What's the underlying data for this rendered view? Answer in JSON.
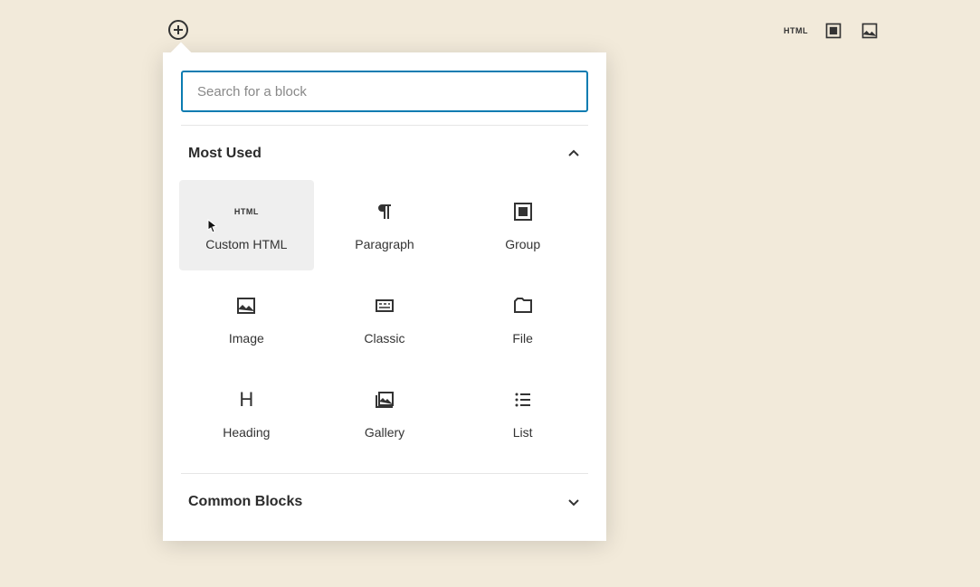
{
  "search": {
    "placeholder": "Search for a block"
  },
  "toolbar": {
    "html_label": "HTML"
  },
  "categories": [
    {
      "title": "Most Used",
      "expanded": true,
      "blocks": [
        {
          "label": "Custom HTML",
          "icon": "html"
        },
        {
          "label": "Paragraph",
          "icon": "paragraph"
        },
        {
          "label": "Group",
          "icon": "group"
        },
        {
          "label": "Image",
          "icon": "image"
        },
        {
          "label": "Classic",
          "icon": "classic"
        },
        {
          "label": "File",
          "icon": "file"
        },
        {
          "label": "Heading",
          "icon": "heading"
        },
        {
          "label": "Gallery",
          "icon": "gallery"
        },
        {
          "label": "List",
          "icon": "list"
        }
      ]
    },
    {
      "title": "Common Blocks",
      "expanded": false,
      "blocks": []
    }
  ]
}
